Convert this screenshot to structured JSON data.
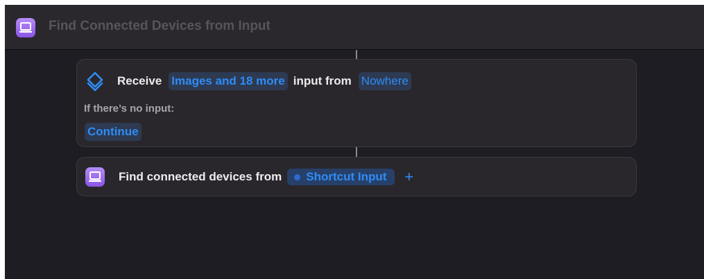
{
  "window": {
    "title": "Find Connected Devices from Input"
  },
  "receive_action": {
    "label_receive": "Receive",
    "input_types": "Images and 18 more",
    "label_input_from": "input from",
    "source": "Nowhere",
    "no_input_label": "If there’s no input:",
    "no_input_behavior": "Continue"
  },
  "find_action": {
    "label": "Find connected devices from",
    "variable": "Shortcut Input",
    "add_symbol": "+"
  },
  "icons": {
    "app_icon": "connected-devices-icon",
    "receive_icon": "shortcuts-layers-icon",
    "variable_icon": "shortcut-input-dot-icon"
  },
  "colors": {
    "accent": "#2f8cf5",
    "app_icon_purple": "#9a63ec",
    "background": "#1f1d24",
    "card": "#29272c"
  }
}
